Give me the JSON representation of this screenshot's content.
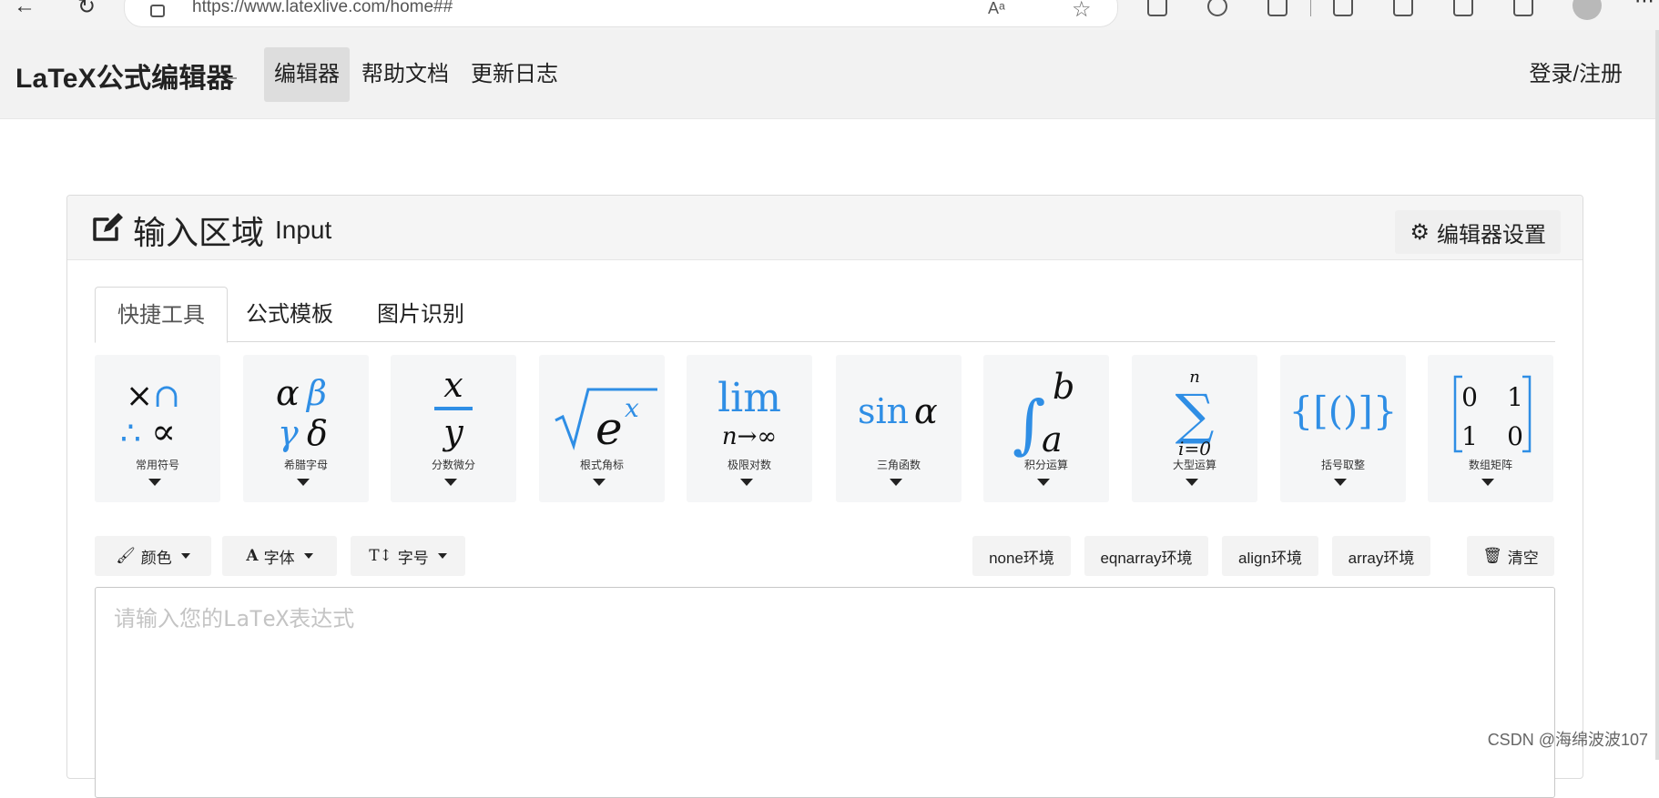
{
  "browser": {
    "url": "https://www.latexlive.com/home##",
    "read_aloud_label": "Aᵃ"
  },
  "header": {
    "brand": "LaTeX公式编辑器",
    "nav": [
      {
        "label": "编辑器",
        "active": true
      },
      {
        "label": "帮助文档",
        "active": false
      },
      {
        "label": "更新日志",
        "active": false
      }
    ],
    "login": "登录/注册"
  },
  "panel": {
    "title": "输入区域",
    "title_en": "Input",
    "settings_label": "编辑器设置",
    "tabs": [
      {
        "label": "快捷工具",
        "active": true
      },
      {
        "label": "公式模板",
        "active": false
      },
      {
        "label": "图片识别",
        "active": false
      }
    ],
    "tools": [
      {
        "label": "常用符号",
        "icon": "common-symbols-icon"
      },
      {
        "label": "希腊字母",
        "icon": "greek-letters-icon"
      },
      {
        "label": "分数微分",
        "icon": "fraction-icon"
      },
      {
        "label": "根式角标",
        "icon": "sqrt-icon"
      },
      {
        "label": "极限对数",
        "icon": "limit-icon"
      },
      {
        "label": "三角函数",
        "icon": "trig-icon"
      },
      {
        "label": "积分运算",
        "icon": "integral-icon"
      },
      {
        "label": "大型运算",
        "icon": "sum-icon"
      },
      {
        "label": "括号取整",
        "icon": "brackets-icon"
      },
      {
        "label": "数组矩阵",
        "icon": "matrix-icon"
      }
    ],
    "glyph_text": {
      "greek_alpha": "α",
      "greek_beta": "β",
      "greek_gamma": "γ",
      "greek_delta": "δ",
      "frac_num": "x",
      "frac_den": "y",
      "sqrt_base": "e",
      "sqrt_exp": "x",
      "lim_word": "lim",
      "lim_sub": "n→∞",
      "sin_word": "sin",
      "sin_arg": "α",
      "int_upper": "b",
      "int_lower": "a",
      "sum_upper": "n",
      "sum_lower": "i=0",
      "brackets": "{[()]}",
      "matrix": [
        "0",
        "1",
        "1",
        "0"
      ]
    },
    "toolbar": {
      "color": "颜色",
      "font": "字体",
      "size": "字号",
      "env_none": "none环境",
      "env_eqnarray": "eqnarray环境",
      "env_align": "align环境",
      "env_array": "array环境",
      "clear": "清空"
    },
    "editor_placeholder": "请输入您的LaTeX表达式"
  },
  "watermark": "CSDN @海绵波波107",
  "colors": {
    "accent_blue": "#2f8ee5",
    "header_bg": "#f2f2f2",
    "nav_active_bg": "#dddddd"
  }
}
